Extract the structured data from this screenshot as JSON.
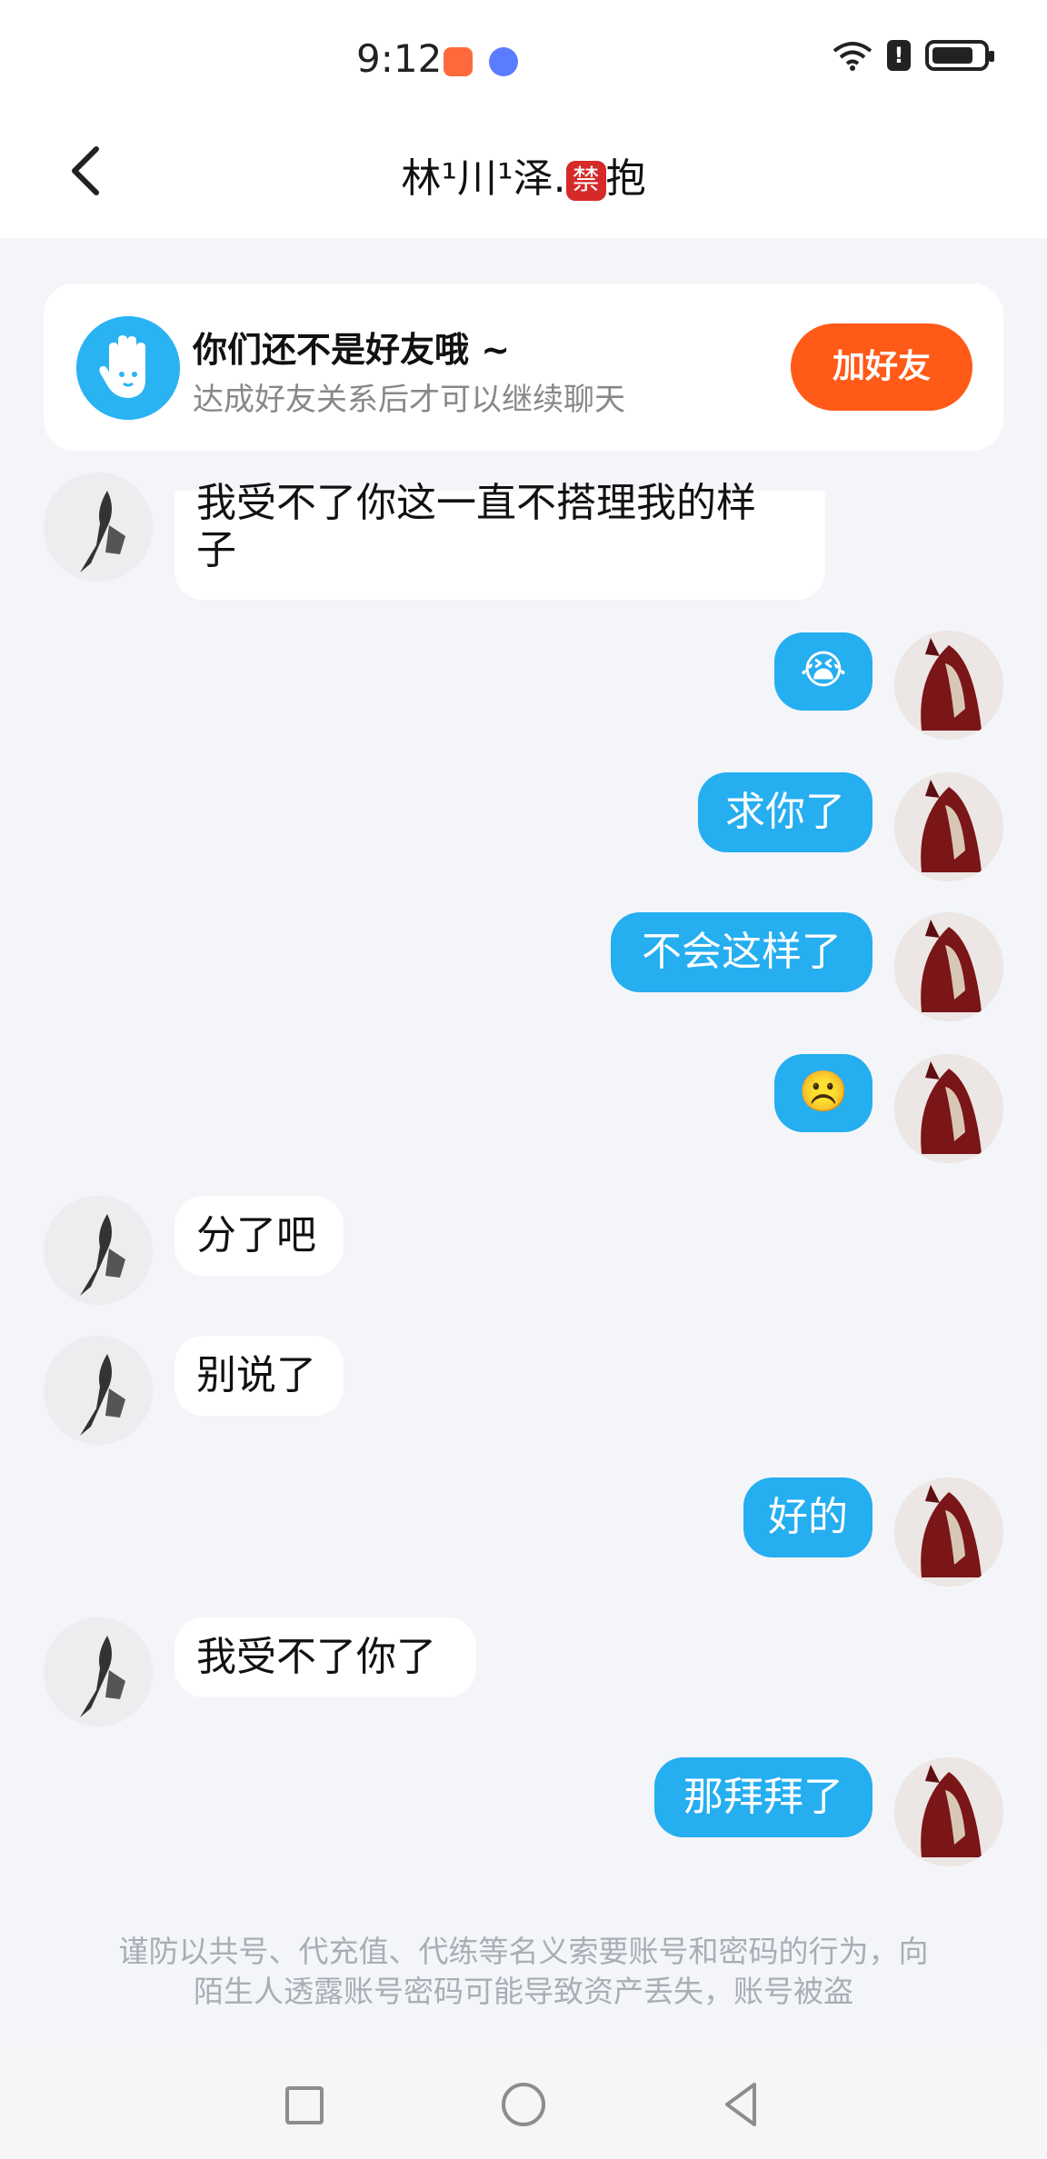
{
  "status_bar": {
    "time": "9:12"
  },
  "header": {
    "title": "林¹川¹泽.",
    "title_badge": "禁",
    "title_tail": "抱"
  },
  "friend_card": {
    "title": "你们还不是好友哦 ~",
    "subtitle": "达成好友关系后才可以继续聊天",
    "button": "加好友"
  },
  "messages": [
    {
      "side": "left",
      "text_line1": "我受不了你这一直不搭理我的样",
      "text_line2": "子"
    },
    {
      "side": "right",
      "emoji": "😭"
    },
    {
      "side": "right",
      "text": "求你了"
    },
    {
      "side": "right",
      "text": "不会这样了"
    },
    {
      "side": "right",
      "emoji": "☹️"
    },
    {
      "side": "left",
      "text": "分了吧"
    },
    {
      "side": "left",
      "text": "别说了"
    },
    {
      "side": "right",
      "text": "好的"
    },
    {
      "side": "left",
      "text": "我受不了你了"
    },
    {
      "side": "right",
      "text": "那拜拜了"
    }
  ],
  "warning": {
    "line1": "谨防以共号、代充值、代练等名义索要账号和密码的行为，向",
    "line2": "陌生人透露账号密码可能导致资产丢失，账号被盗"
  },
  "colors": {
    "accent": "#25aef0",
    "button": "#ff5a17"
  },
  "icons": [
    "back-icon",
    "wifi-icon",
    "alert-icon",
    "battery-icon",
    "hand-icon",
    "square-icon",
    "circle-icon",
    "triangle-back-icon"
  ]
}
